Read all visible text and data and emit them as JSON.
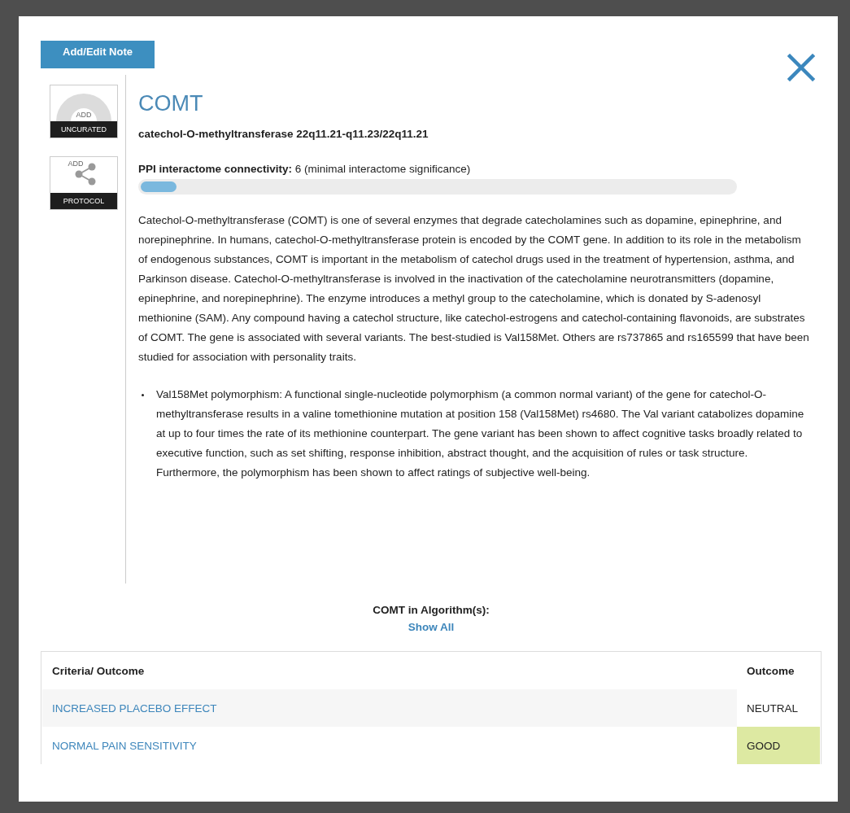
{
  "note_button": "Add/Edit Note",
  "badges": [
    {
      "kind": "gauge",
      "top": "ADD",
      "label": "UNCURATED"
    },
    {
      "kind": "share",
      "top": "ADD",
      "label": "PROTOCOL"
    }
  ],
  "gene": {
    "symbol": "COMT",
    "full_name": "catechol-O-methyltransferase 22q11.21-q11.23/22q11.21"
  },
  "connectivity": {
    "label": "PPI interactome connectivity:",
    "value": "6 (minimal interactome significance)",
    "level": 0.06
  },
  "description": "Catechol-O-methyltransferase (COMT)  is one of several enzymes that degrade catecholamines such as dopamine, epinephrine, and norepinephrine. In humans, catechol-O-methyltransferase protein is encoded by the COMT gene. In addition to its role in the metabolism of endogenous substances, COMT is important in the metabolism of catechol drugs used in the treatment of hypertension, asthma, and Parkinson disease. Catechol-O-methyltransferase is involved in the inactivation of the catecholamine neurotransmitters (dopamine, epinephrine, and norepinephrine). The enzyme introduces a methyl group to the catecholamine, which is donated by S-adenosyl methionine (SAM). Any compound having a catechol structure, like catechol-estrogens and catechol-containing flavonoids, are substrates of COMT.   The gene is associated with several variants. The best-studied is Val158Met. Others are rs737865 and rs165599 that have been studied  for association with personality traits.",
  "bullets": [
    "Val158Met polymorphism: A functional single-nucleotide polymorphism (a common normal variant) of the gene for catechol-O-methyltransferase results in a valine tomethionine mutation at position 158 (Val158Met) rs4680. The Val variant catabolizes dopamine at up to four times the rate of its methionine counterpart. The gene variant has been shown to affect cognitive tasks broadly related to executive function, such as set shifting, response inhibition, abstract thought, and the acquisition of rules or task structure. Furthermore, the polymorphism has been shown to affect ratings of subjective well-being."
  ],
  "algorithms": {
    "title": "COMT in Algorithm(s):",
    "show_all": "Show All"
  },
  "table": {
    "columns": [
      "Criteria/ Outcome",
      "Outcome"
    ],
    "rows": [
      {
        "criteria": "INCREASED PLACEBO EFFECT",
        "outcome": "NEUTRAL",
        "color": "#ffffff"
      },
      {
        "criteria": "NORMAL PAIN SENSITIVITY",
        "outcome": "GOOD",
        "color": "#dde9a2"
      }
    ]
  }
}
